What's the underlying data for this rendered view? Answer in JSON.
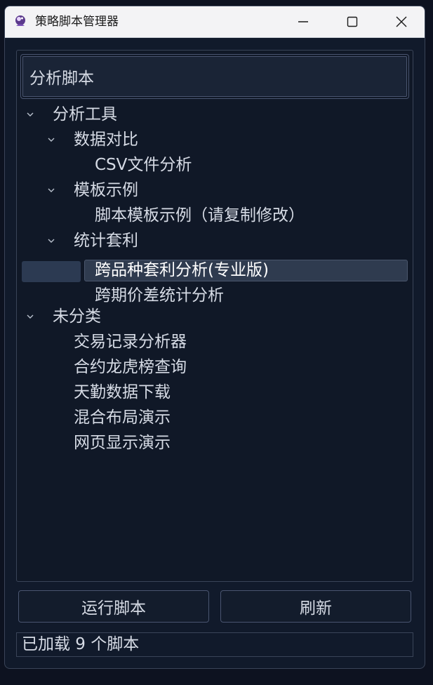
{
  "window": {
    "title": "策略脚本管理器"
  },
  "search": {
    "value": "分析脚本"
  },
  "tree": {
    "analysis_tools": {
      "label": "分析工具",
      "data_compare": {
        "label": "数据对比",
        "items": [
          "CSV文件分析"
        ]
      },
      "template_example": {
        "label": "模板示例",
        "items": [
          "脚本模板示例（请复制修改）"
        ]
      },
      "arbitrage_stats": {
        "label": "统计套利",
        "items": [
          "跨品种套利分析(专业版)",
          "跨期价差统计分析"
        ]
      }
    },
    "uncategorized": {
      "label": "未分类",
      "items": [
        "交易记录分析器",
        "合约龙虎榜查询",
        "天勤数据下载",
        "混合布局演示",
        "网页显示演示"
      ]
    },
    "selected_item": "跨品种套利分析(专业版)"
  },
  "buttons": {
    "run": "运行脚本",
    "refresh": "刷新"
  },
  "status": {
    "text": "已加载 9 个脚本"
  },
  "colors": {
    "background": "#111a2b",
    "titlebar": "#f3f3f5",
    "text": "#d6dbe5",
    "selection": "#2f3b4f",
    "border": "#4a5570"
  }
}
